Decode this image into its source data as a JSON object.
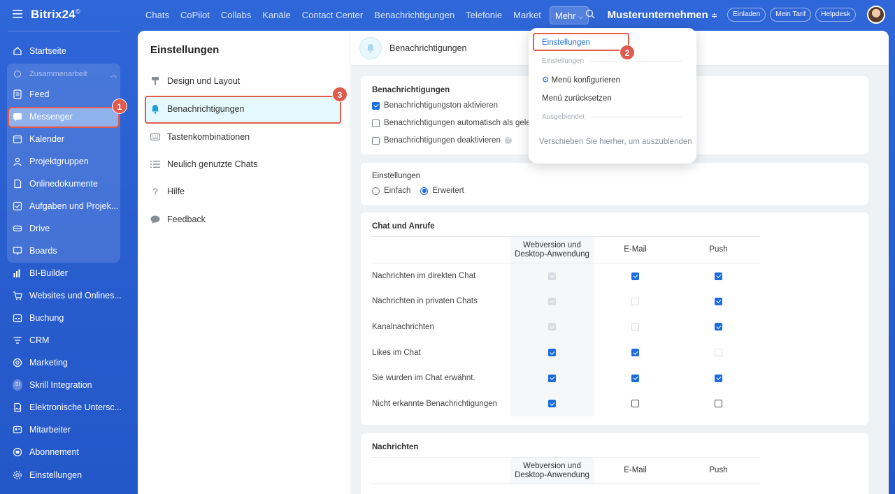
{
  "app": {
    "logo": "Bitrix24",
    "logo_mark": "©"
  },
  "topnav": {
    "items": [
      "Chats",
      "CoPilot",
      "Collabs",
      "Kanäle",
      "Contact Center",
      "Benachrichtigungen",
      "Telefonie",
      "Market"
    ],
    "more_label": "Mehr",
    "company": "Musterunternehmen",
    "invite": "Einladen",
    "plan": "Mein Tarif",
    "helpdesk": "Helpdesk"
  },
  "sidebar": {
    "home": "Startseite",
    "group_label": "Zusammenarbeit",
    "items": [
      {
        "label": "Feed",
        "icon": "feed-icon"
      },
      {
        "label": "Messenger",
        "icon": "messenger-icon"
      },
      {
        "label": "Kalender",
        "icon": "calendar-icon"
      },
      {
        "label": "Projektgruppen",
        "icon": "groups-icon"
      },
      {
        "label": "Onlinedokumente",
        "icon": "document-icon"
      },
      {
        "label": "Aufgaben und Projek...",
        "icon": "tasks-icon"
      },
      {
        "label": "Drive",
        "icon": "drive-icon"
      },
      {
        "label": "Boards",
        "icon": "boards-icon"
      },
      {
        "label": "BI-Builder",
        "icon": "chart-icon"
      },
      {
        "label": "Websites und Onlines...",
        "icon": "cart-icon"
      },
      {
        "label": "Buchung",
        "icon": "booking-icon"
      },
      {
        "label": "CRM",
        "icon": "crm-icon"
      },
      {
        "label": "Marketing",
        "icon": "marketing-icon"
      },
      {
        "label": "Skrill Integration",
        "icon": "si-icon",
        "icon_text": "SI"
      },
      {
        "label": "Elektronische Untersc...",
        "icon": "signature-icon"
      },
      {
        "label": "Mitarbeiter",
        "icon": "employees-icon"
      },
      {
        "label": "Abonnement",
        "icon": "subscription-icon"
      },
      {
        "label": "Einstellungen",
        "icon": "settings-icon"
      }
    ]
  },
  "badges": {
    "one": "1",
    "two": "2",
    "three": "3"
  },
  "settings_menu": {
    "title": "Einstellungen",
    "items": [
      {
        "label": "Design und Layout",
        "icon": "paint-roller-icon"
      },
      {
        "label": "Benachrichtigungen",
        "icon": "bell-icon"
      },
      {
        "label": "Tastenkombinationen",
        "icon": "keyboard-icon"
      },
      {
        "label": "Neulich genutzte Chats",
        "icon": "list-icon"
      },
      {
        "label": "Hilfe",
        "icon": "question-icon"
      },
      {
        "label": "Feedback",
        "icon": "speech-bubble-icon"
      }
    ]
  },
  "content": {
    "header": "Benachrichtigungen",
    "notifications": {
      "title": "Benachrichtigungen",
      "options": [
        {
          "label": "Benachrichtigungston aktivieren",
          "checked": true
        },
        {
          "label": "Benachrichtigungen automatisch als geles",
          "checked": false
        },
        {
          "label": "Benachrichtigungen deaktivieren",
          "checked": false
        }
      ]
    },
    "mode": {
      "title": "Einstellungen",
      "simple": "Einfach",
      "advanced": "Erweitert",
      "selected": "Erweitert"
    },
    "chat_calls": {
      "title": "Chat und Anrufe",
      "col_web": "Webversion und",
      "col_web2": "Desktop-Anwendung",
      "col_email": "E-Mail",
      "col_push": "Push",
      "rows": [
        {
          "label": "Nachrichten im direkten Chat",
          "web": "locked-on",
          "email": "on",
          "push": "on"
        },
        {
          "label": "Nachrichten in privaten Chats",
          "web": "locked-on",
          "email": "disabled",
          "push": "on"
        },
        {
          "label": "Kanalnachrichten",
          "web": "locked-on",
          "email": "disabled",
          "push": "on"
        },
        {
          "label": "Likes im Chat",
          "web": "on",
          "email": "on",
          "push": "disabled"
        },
        {
          "label": "Sie wurden im Chat erwähnt.",
          "web": "on",
          "email": "on",
          "push": "on"
        },
        {
          "label": "Nicht erkannte Benachrichtigungen",
          "web": "on",
          "email": "off",
          "push": "off"
        }
      ]
    },
    "messages": {
      "title": "Nachrichten",
      "col_web": "Webversion und",
      "col_web2": "Desktop-Anwendung",
      "col_email": "E-Mail",
      "col_push": "Push"
    }
  },
  "dropdown": {
    "settings": "Einstellungen",
    "section_settings": "Einstellungen",
    "configure": "Menü konfigurieren",
    "reset": "Menü zurücksetzen",
    "section_hidden": "Ausgeblendet",
    "drag_hint": "Verschieben Sie hierher, um auszublenden"
  },
  "colors": {
    "accent": "#1a6ce0",
    "highlight": "#e05a4e",
    "sidebar": "#2f66d8"
  }
}
